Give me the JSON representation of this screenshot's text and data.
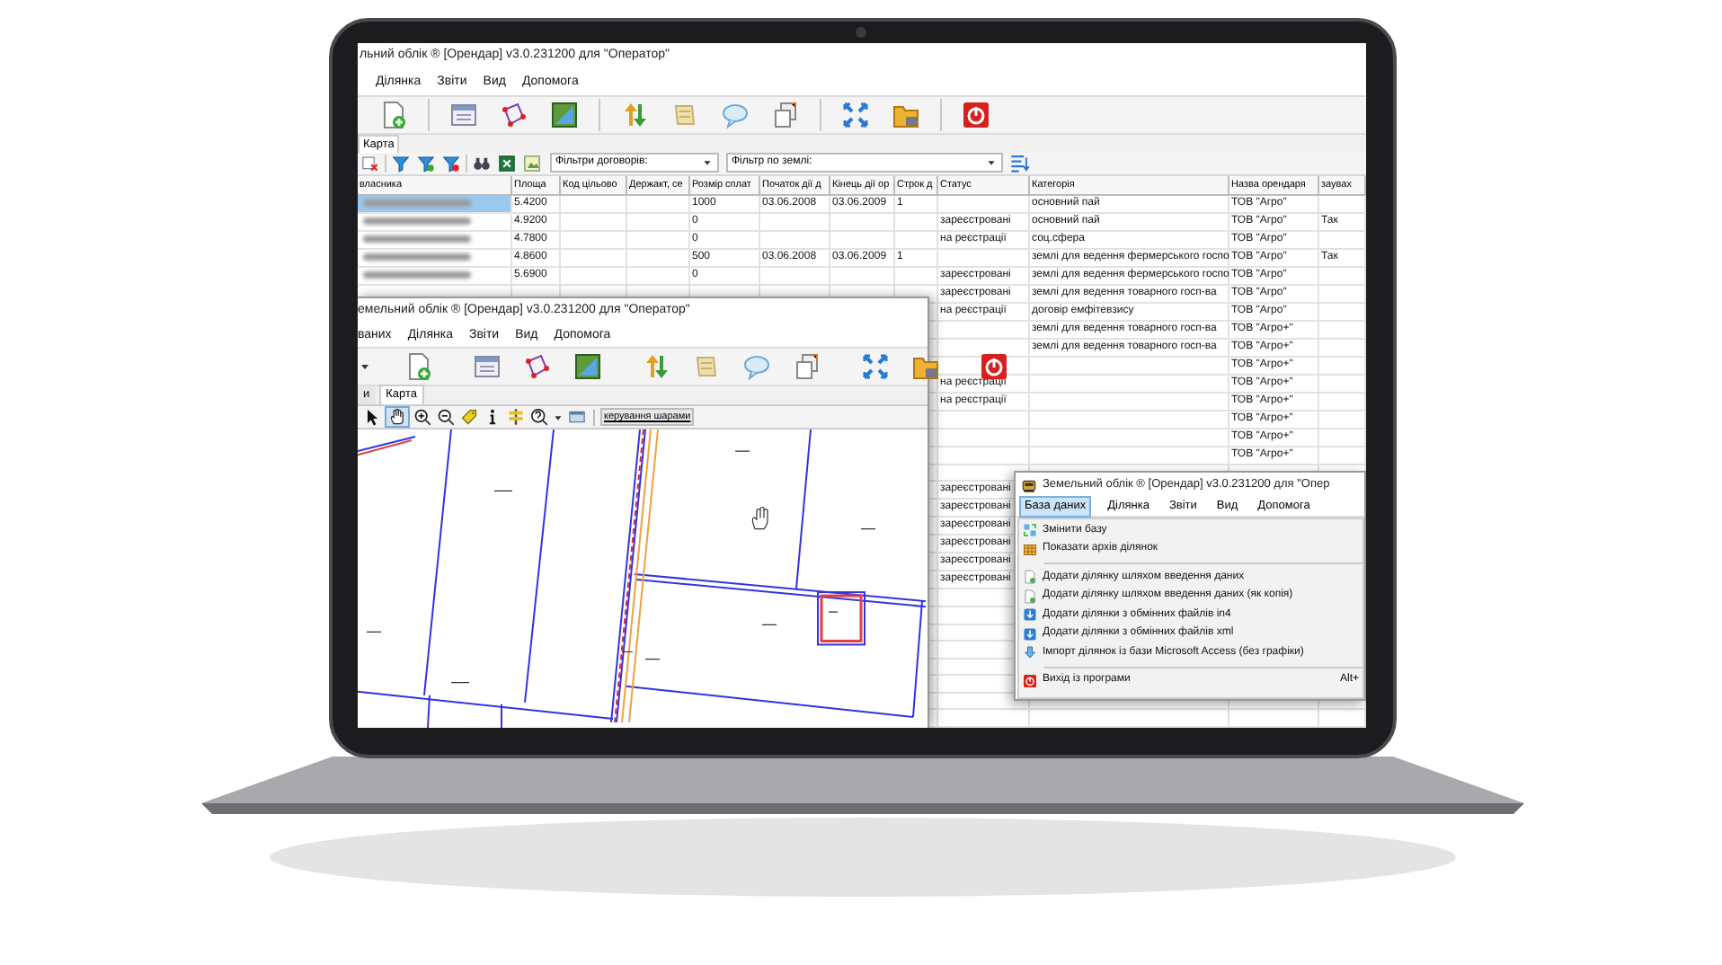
{
  "table_window": {
    "title": "льний облік ® [Орендар] v3.0.231200 для \"Оператор\"",
    "menu": [
      "Ділянка",
      "Звіти",
      "Вид",
      "Допомога"
    ],
    "tabs": [
      {
        "label": "Карта",
        "selected": true
      }
    ],
    "filters": [
      {
        "label": "Фільтри договорів:"
      },
      {
        "label": "Фільтр по землі:"
      }
    ],
    "columns": [
      "власника",
      "Площа",
      "Код цільово",
      "Держакт, се",
      "Розмір сплат",
      "Початок дії д",
      "Кінець дії ор",
      "Строк д",
      "Статус",
      "Категорія",
      "Назва орендаря",
      "заувах"
    ],
    "rows": [
      {
        "owner_redacted": true,
        "selected": true,
        "area": "5.4200",
        "rent": "1000",
        "start": "03.06.2008",
        "end": "03.06.2009",
        "term": "1",
        "category": "основний пай",
        "lessee": "ТОВ \"Агро\""
      },
      {
        "owner_redacted": true,
        "selected": false,
        "area": "4.9200",
        "rent": "0",
        "status": "зареєстровані",
        "category": "основний пай",
        "lessee": "ТОВ \"Агро\"",
        "note": "Так"
      },
      {
        "owner_redacted": true,
        "selected": false,
        "area": "4.7800",
        "rent": "0",
        "status": "на реєстрації",
        "category": "соц.сфера",
        "lessee": "ТОВ \"Агро\""
      },
      {
        "owner_redacted": true,
        "selected": false,
        "area": "4.8600",
        "rent": "500",
        "start": "03.06.2008",
        "end": "03.06.2009",
        "term": "1",
        "category": "землі для ведення фермерського госпо",
        "lessee": "ТОВ \"Агро\"",
        "note": "Так"
      },
      {
        "owner_redacted": true,
        "selected": false,
        "area": "5.6900",
        "rent": "0",
        "status": "зареєстровані",
        "category": "землі для ведення фермерського госпо",
        "lessee": "ТОВ \"Агро\""
      },
      {
        "status": "зареєстровані",
        "category": "землі для ведення товарного госп-ва",
        "lessee": "ТОВ \"Агро\""
      },
      {
        "status": "на реєстрації",
        "category": "договір емфітевзису",
        "lessee": "ТОВ \"Агро\""
      },
      {
        "category": "землі для ведення товарного госп-ва",
        "lessee": "ТОВ \"Агро+\""
      },
      {
        "category": "землі для ведення товарного госп-ва",
        "lessee": "ТОВ \"Агро+\""
      },
      {
        "lessee": "ТОВ \"Агро+\""
      },
      {
        "status": "на реєстрації",
        "lessee": "ТОВ \"Агро+\""
      },
      {
        "status": "на реєстрації",
        "lessee": "ТОВ \"Агро+\""
      },
      {
        "lessee": "ТОВ \"Агро+\""
      },
      {
        "lessee": "ТОВ \"Агро+\""
      },
      {
        "lessee": "ТОВ \"Агро+\""
      },
      {},
      {
        "status": "зареєстровані"
      },
      {
        "status": "зареєстровані"
      },
      {
        "status": "зареєстровані"
      },
      {
        "status": "зареєстровані"
      },
      {
        "status": "зареєстровані"
      },
      {
        "status": "зареєстровані"
      }
    ]
  },
  "map_window": {
    "title": "емельний облік ® [Орендар] v3.0.231200 для \"Оператор\"",
    "menu": [
      "ваних",
      "Ділянка",
      "Звіти",
      "Вид",
      "Допомога"
    ],
    "tabs": [
      {
        "label": "и",
        "selected": false
      },
      {
        "label": "Карта",
        "selected": true
      }
    ],
    "layers_button": "керування шарами"
  },
  "menu_window": {
    "title": "Земельний облік ® [Орендар] v3.0.231200 для \"Опер",
    "menu": [
      {
        "label": "База даних",
        "selected": true
      },
      {
        "label": "Ділянка",
        "selected": false
      },
      {
        "label": "Звіти",
        "selected": false
      },
      {
        "label": "Вид",
        "selected": false
      },
      {
        "label": "Допомога",
        "selected": false
      }
    ],
    "items": [
      {
        "kind": "item",
        "label": "Змінити базу"
      },
      {
        "kind": "item",
        "label": "Показати архів ділянок"
      },
      {
        "kind": "separator"
      },
      {
        "kind": "item",
        "label": "Додати ділянку шляхом введення даних"
      },
      {
        "kind": "item",
        "label": "Додати ділянку шляхом введення даних (як копія)"
      },
      {
        "kind": "item",
        "label": "Додати ділянки з обмінних файлів in4"
      },
      {
        "kind": "item",
        "label": "Додати ділянки з обмінних файлів xml"
      },
      {
        "kind": "item",
        "label": "Імпорт ділянок із бази Microsoft Access (без графіки)"
      },
      {
        "kind": "separator"
      },
      {
        "kind": "item",
        "label": "Вихід із програми",
        "shortcut": "Alt+"
      }
    ]
  }
}
